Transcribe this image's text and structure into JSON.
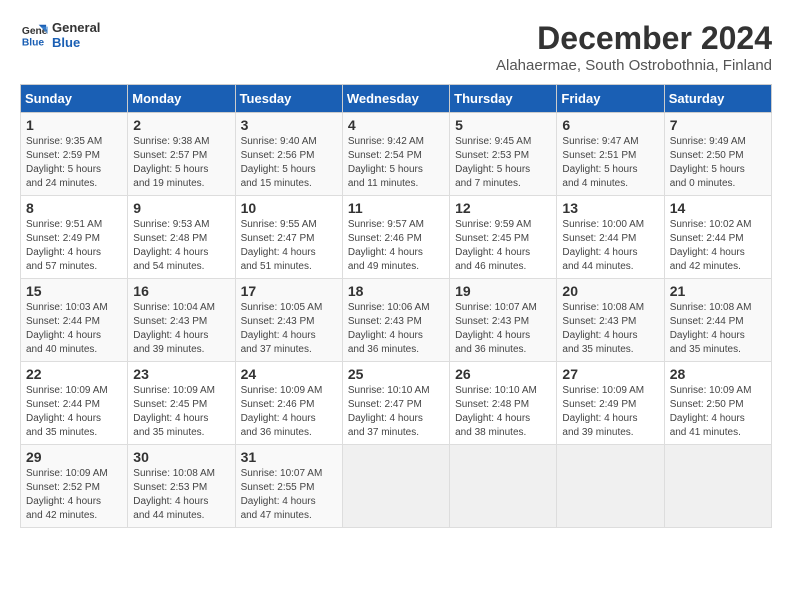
{
  "logo": {
    "line1": "General",
    "line2": "Blue"
  },
  "title": "December 2024",
  "subtitle": "Alahaermae, South Ostrobothnia, Finland",
  "days_of_week": [
    "Sunday",
    "Monday",
    "Tuesday",
    "Wednesday",
    "Thursday",
    "Friday",
    "Saturday"
  ],
  "weeks": [
    [
      {
        "day": "1",
        "info": "Sunrise: 9:35 AM\nSunset: 2:59 PM\nDaylight: 5 hours\nand 24 minutes."
      },
      {
        "day": "2",
        "info": "Sunrise: 9:38 AM\nSunset: 2:57 PM\nDaylight: 5 hours\nand 19 minutes."
      },
      {
        "day": "3",
        "info": "Sunrise: 9:40 AM\nSunset: 2:56 PM\nDaylight: 5 hours\nand 15 minutes."
      },
      {
        "day": "4",
        "info": "Sunrise: 9:42 AM\nSunset: 2:54 PM\nDaylight: 5 hours\nand 11 minutes."
      },
      {
        "day": "5",
        "info": "Sunrise: 9:45 AM\nSunset: 2:53 PM\nDaylight: 5 hours\nand 7 minutes."
      },
      {
        "day": "6",
        "info": "Sunrise: 9:47 AM\nSunset: 2:51 PM\nDaylight: 5 hours\nand 4 minutes."
      },
      {
        "day": "7",
        "info": "Sunrise: 9:49 AM\nSunset: 2:50 PM\nDaylight: 5 hours\nand 0 minutes."
      }
    ],
    [
      {
        "day": "8",
        "info": "Sunrise: 9:51 AM\nSunset: 2:49 PM\nDaylight: 4 hours\nand 57 minutes."
      },
      {
        "day": "9",
        "info": "Sunrise: 9:53 AM\nSunset: 2:48 PM\nDaylight: 4 hours\nand 54 minutes."
      },
      {
        "day": "10",
        "info": "Sunrise: 9:55 AM\nSunset: 2:47 PM\nDaylight: 4 hours\nand 51 minutes."
      },
      {
        "day": "11",
        "info": "Sunrise: 9:57 AM\nSunset: 2:46 PM\nDaylight: 4 hours\nand 49 minutes."
      },
      {
        "day": "12",
        "info": "Sunrise: 9:59 AM\nSunset: 2:45 PM\nDaylight: 4 hours\nand 46 minutes."
      },
      {
        "day": "13",
        "info": "Sunrise: 10:00 AM\nSunset: 2:44 PM\nDaylight: 4 hours\nand 44 minutes."
      },
      {
        "day": "14",
        "info": "Sunrise: 10:02 AM\nSunset: 2:44 PM\nDaylight: 4 hours\nand 42 minutes."
      }
    ],
    [
      {
        "day": "15",
        "info": "Sunrise: 10:03 AM\nSunset: 2:44 PM\nDaylight: 4 hours\nand 40 minutes."
      },
      {
        "day": "16",
        "info": "Sunrise: 10:04 AM\nSunset: 2:43 PM\nDaylight: 4 hours\nand 39 minutes."
      },
      {
        "day": "17",
        "info": "Sunrise: 10:05 AM\nSunset: 2:43 PM\nDaylight: 4 hours\nand 37 minutes."
      },
      {
        "day": "18",
        "info": "Sunrise: 10:06 AM\nSunset: 2:43 PM\nDaylight: 4 hours\nand 36 minutes."
      },
      {
        "day": "19",
        "info": "Sunrise: 10:07 AM\nSunset: 2:43 PM\nDaylight: 4 hours\nand 36 minutes."
      },
      {
        "day": "20",
        "info": "Sunrise: 10:08 AM\nSunset: 2:43 PM\nDaylight: 4 hours\nand 35 minutes."
      },
      {
        "day": "21",
        "info": "Sunrise: 10:08 AM\nSunset: 2:44 PM\nDaylight: 4 hours\nand 35 minutes."
      }
    ],
    [
      {
        "day": "22",
        "info": "Sunrise: 10:09 AM\nSunset: 2:44 PM\nDaylight: 4 hours\nand 35 minutes."
      },
      {
        "day": "23",
        "info": "Sunrise: 10:09 AM\nSunset: 2:45 PM\nDaylight: 4 hours\nand 35 minutes."
      },
      {
        "day": "24",
        "info": "Sunrise: 10:09 AM\nSunset: 2:46 PM\nDaylight: 4 hours\nand 36 minutes."
      },
      {
        "day": "25",
        "info": "Sunrise: 10:10 AM\nSunset: 2:47 PM\nDaylight: 4 hours\nand 37 minutes."
      },
      {
        "day": "26",
        "info": "Sunrise: 10:10 AM\nSunset: 2:48 PM\nDaylight: 4 hours\nand 38 minutes."
      },
      {
        "day": "27",
        "info": "Sunrise: 10:09 AM\nSunset: 2:49 PM\nDaylight: 4 hours\nand 39 minutes."
      },
      {
        "day": "28",
        "info": "Sunrise: 10:09 AM\nSunset: 2:50 PM\nDaylight: 4 hours\nand 41 minutes."
      }
    ],
    [
      {
        "day": "29",
        "info": "Sunrise: 10:09 AM\nSunset: 2:52 PM\nDaylight: 4 hours\nand 42 minutes."
      },
      {
        "day": "30",
        "info": "Sunrise: 10:08 AM\nSunset: 2:53 PM\nDaylight: 4 hours\nand 44 minutes."
      },
      {
        "day": "31",
        "info": "Sunrise: 10:07 AM\nSunset: 2:55 PM\nDaylight: 4 hours\nand 47 minutes."
      },
      null,
      null,
      null,
      null
    ]
  ]
}
